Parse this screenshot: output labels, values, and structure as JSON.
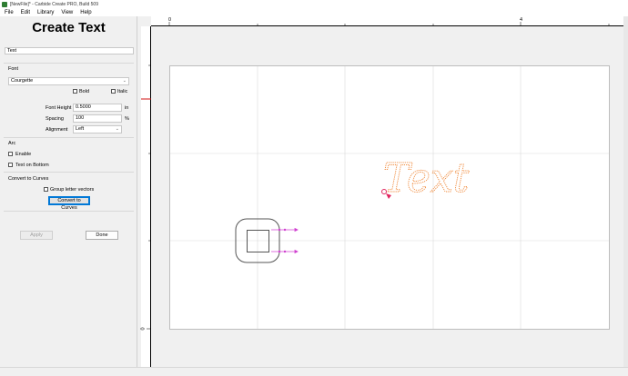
{
  "window": {
    "title": "[NewFile]* - Carbide Create PRO, Build 509"
  },
  "menu": [
    {
      "label": "File"
    },
    {
      "label": "Edit"
    },
    {
      "label": "Library"
    },
    {
      "label": "View"
    },
    {
      "label": "Help"
    }
  ],
  "panel": {
    "heading": "Create Text",
    "text_value": "Text",
    "font_section": "Font",
    "font_name": "Courgette",
    "bold_label": "Bold",
    "bold_checked": false,
    "italic_label": "Italic",
    "italic_checked": false,
    "font_height_label": "Font Height",
    "font_height_value": "0.5000",
    "font_height_unit": "in",
    "spacing_label": "Spacing",
    "spacing_value": "100",
    "spacing_unit": "%",
    "alignment_label": "Alignment",
    "alignment_value": "Left",
    "arc_section": "Arc",
    "enable_label": "Enable",
    "text_on_bottom_label": "Text on Bottom",
    "curves_section": "Convert to Curves",
    "group_vectors_label": "Group letter vectors",
    "convert_button": "Convert to Curves",
    "apply_button": "Apply",
    "done_button": "Done"
  },
  "ruler": {
    "top_labels": [
      "0",
      "4"
    ],
    "left_labels": [
      "0"
    ]
  },
  "canvas": {
    "text_object": "Text",
    "text_color": "#f08a3c",
    "handle_color": "#e0245e",
    "arrow_color": "#d040d0"
  }
}
